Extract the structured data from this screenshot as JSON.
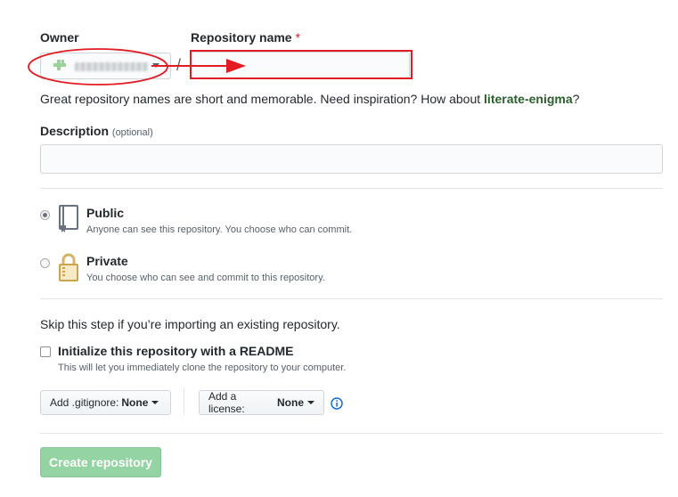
{
  "owner": {
    "label": "Owner"
  },
  "repository_name": {
    "label": "Repository name",
    "required_marker": "*",
    "value": ""
  },
  "separator": "/",
  "hint": {
    "text": "Great repository names are short and memorable. Need inspiration? How about",
    "suggestion": "literate-enigma",
    "suffix": "?"
  },
  "description": {
    "label": "Description",
    "optional": "(optional)",
    "value": ""
  },
  "visibility": {
    "public": {
      "title": "Public",
      "note": "Anyone can see this repository. You choose who can commit."
    },
    "private": {
      "title": "Private",
      "note": "You choose who can see and commit to this repository."
    },
    "selected": "public"
  },
  "import_note": "Skip this step if you’re importing an existing repository.",
  "readme": {
    "label": "Initialize this repository with a README",
    "note": "This will let you immediately clone the repository to your computer.",
    "checked": false
  },
  "gitignore": {
    "prefix": "Add .gitignore:",
    "value": "None"
  },
  "license": {
    "prefix": "Add a license:",
    "value": "None"
  },
  "create_button": {
    "label": "Create repository",
    "enabled": false
  },
  "colors": {
    "annotation": "#e31c23",
    "create_button_bg": "#94d3a2",
    "suggestion_text": "#2c5f2d"
  },
  "icons": {
    "owner_avatar": "identicon-avatar",
    "public": "repo-book-icon",
    "private": "lock-icon",
    "info": "info-icon"
  }
}
